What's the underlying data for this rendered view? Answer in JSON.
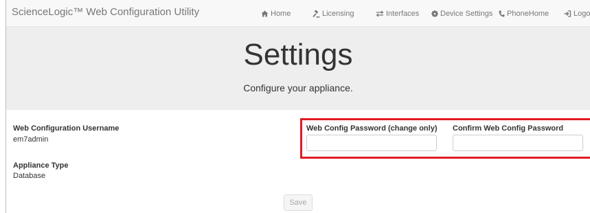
{
  "navbar": {
    "brand": "ScienceLogic™ Web Configuration Utility",
    "items": [
      {
        "label": "Home",
        "icon": "home-icon"
      },
      {
        "label": "Licensing",
        "icon": "gavel-icon"
      },
      {
        "label": "Interfaces",
        "icon": "transfer-icon"
      },
      {
        "label": "Device Settings",
        "icon": "gear-icon"
      },
      {
        "label": "PhoneHome",
        "icon": "phone-icon"
      },
      {
        "label": "Logout",
        "icon": "logout-icon"
      }
    ]
  },
  "header": {
    "title": "Settings",
    "subtitle": "Configure your appliance."
  },
  "form": {
    "username_label": "Web Configuration Username",
    "username_value": "em7admin",
    "appliance_type_label": "Appliance Type",
    "appliance_type_value": "Database",
    "password_label": "Web Config Password (change only)",
    "password_value": "",
    "confirm_password_label": "Confirm Web Config Password",
    "confirm_password_value": "",
    "save_label": "Save"
  },
  "colors": {
    "highlight": "#e11b22",
    "navbar_bg": "#f8f8f8",
    "jumbotron_bg": "#eeeeee"
  }
}
